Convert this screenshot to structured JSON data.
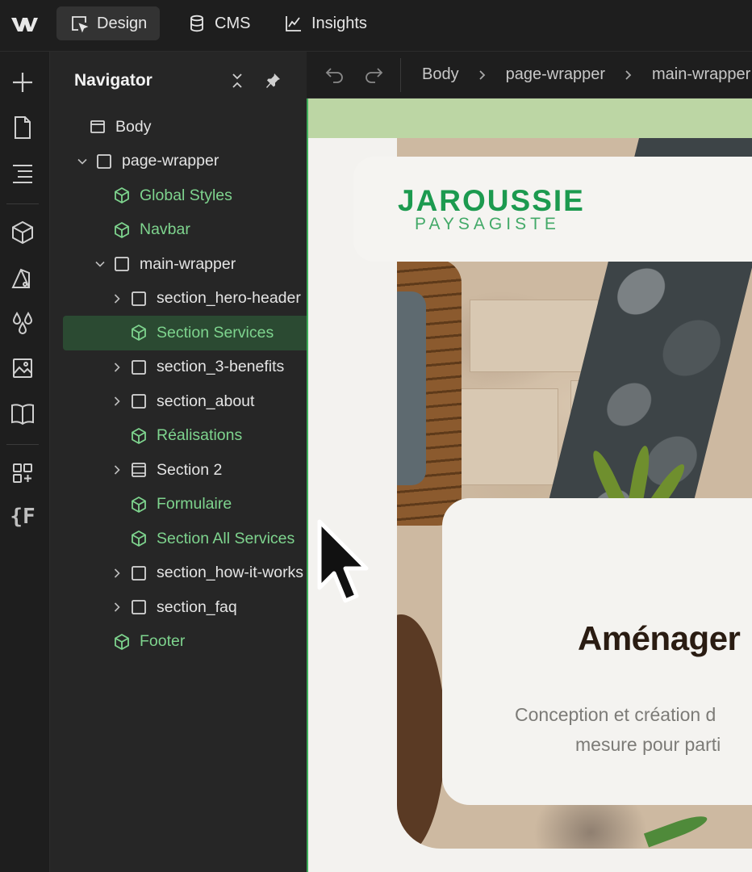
{
  "topbar": {
    "tabs": [
      {
        "label": "Design",
        "icon": "design-icon",
        "active": true
      },
      {
        "label": "CMS",
        "icon": "database-icon",
        "active": false
      },
      {
        "label": "Insights",
        "icon": "chart-line-icon",
        "active": false
      }
    ]
  },
  "navigator": {
    "title": "Navigator",
    "tree": [
      {
        "label": "Body",
        "type": "body",
        "depth": 0,
        "caret": "none",
        "selected": false
      },
      {
        "label": "page-wrapper",
        "type": "box",
        "depth": 0,
        "caret": "down",
        "selected": false
      },
      {
        "label": "Global Styles",
        "type": "component",
        "depth": 1,
        "caret": "none",
        "selected": false
      },
      {
        "label": "Navbar",
        "type": "component",
        "depth": 1,
        "caret": "none",
        "selected": false
      },
      {
        "label": "main-wrapper",
        "type": "box",
        "depth": 1,
        "caret": "down",
        "selected": false
      },
      {
        "label": "section_hero-header",
        "type": "box",
        "depth": 2,
        "caret": "right",
        "selected": false
      },
      {
        "label": "Section Services",
        "type": "component",
        "depth": 2,
        "caret": "none",
        "selected": true
      },
      {
        "label": "section_3-benefits",
        "type": "box",
        "depth": 2,
        "caret": "right",
        "selected": false
      },
      {
        "label": "section_about",
        "type": "box",
        "depth": 2,
        "caret": "right",
        "selected": false
      },
      {
        "label": "Réalisations",
        "type": "component",
        "depth": 2,
        "caret": "none",
        "selected": false
      },
      {
        "label": "Section 2",
        "type": "section",
        "depth": 2,
        "caret": "right",
        "selected": false
      },
      {
        "label": "Formulaire",
        "type": "component",
        "depth": 2,
        "caret": "none",
        "selected": false
      },
      {
        "label": "Section All Services",
        "type": "component",
        "depth": 2,
        "caret": "none",
        "selected": false
      },
      {
        "label": "section_how-it-works",
        "type": "box",
        "depth": 2,
        "caret": "right",
        "selected": false
      },
      {
        "label": "section_faq",
        "type": "box",
        "depth": 2,
        "caret": "right",
        "selected": false
      },
      {
        "label": "Footer",
        "type": "component",
        "depth": 1,
        "caret": "none",
        "selected": false
      }
    ]
  },
  "breadcrumb": {
    "items": [
      "Body",
      "page-wrapper",
      "main-wrapper"
    ]
  },
  "site": {
    "logo_main": "JAROUSSIE",
    "logo_sub": "PAYSAGISTE",
    "hero_title": "Aménager",
    "hero_desc_line1": "Conception et création d",
    "hero_desc_line2": "mesure pour parti"
  },
  "colors": {
    "component_green": "#7ed48e",
    "selection_bg": "#2b4a32",
    "canvas_outline": "#3fae5a",
    "brand_green": "#1c9a4f"
  }
}
